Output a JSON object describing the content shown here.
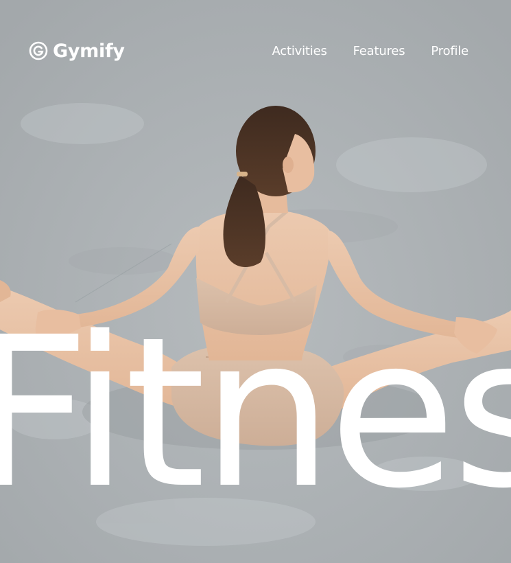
{
  "brand": {
    "name": "Gymify",
    "icon": "g-circle-logo-icon"
  },
  "nav": {
    "items": [
      {
        "label": "Activities"
      },
      {
        "label": "Features"
      },
      {
        "label": "Profile"
      }
    ]
  },
  "hero": {
    "headline": "Fitness"
  },
  "colors": {
    "text": "#ffffff",
    "background_floor": "#b4b9bc",
    "outfit": "#d9bca6",
    "skin": "#e9c3a6",
    "hair": "#4a3225"
  }
}
